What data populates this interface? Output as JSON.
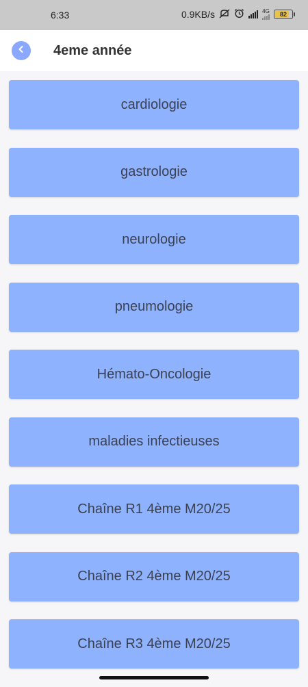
{
  "status_bar": {
    "time": "6:33",
    "speed": "0.9KB/s",
    "network_label": "4G",
    "battery": "82"
  },
  "header": {
    "title": "4eme année"
  },
  "courses": [
    {
      "label": "cardiologie"
    },
    {
      "label": "gastrologie"
    },
    {
      "label": "neurologie"
    },
    {
      "label": "pneumologie"
    },
    {
      "label": "Hémato-Oncologie"
    },
    {
      "label": "maladies infectieuses"
    },
    {
      "label": "Chaîne R1 4ème M20/25"
    },
    {
      "label": "Chaîne R2 4ème M20/25"
    },
    {
      "label": "Chaîne R3 4ème M20/25"
    }
  ],
  "colors": {
    "accent": "#8fb2ff",
    "back_button": "#8aa8ff",
    "text": "#3b4150"
  }
}
